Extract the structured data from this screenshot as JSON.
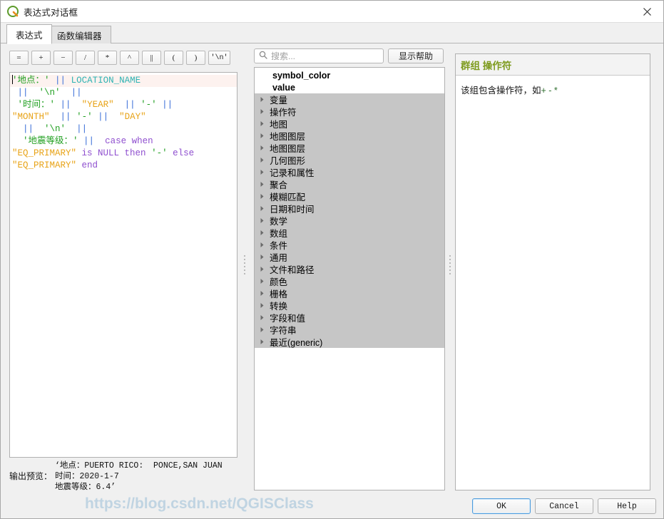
{
  "window": {
    "title": "表达式对话框",
    "logo_icon": "qgis-logo-icon",
    "close_icon": "close-icon"
  },
  "tabs": [
    {
      "id": "expression",
      "label": "表达式",
      "active": true
    },
    {
      "id": "function-editor",
      "label": "函数编辑器",
      "active": false
    }
  ],
  "operator_toolbar": {
    "buttons": [
      {
        "name": "equals",
        "label": "="
      },
      {
        "name": "plus",
        "label": "+"
      },
      {
        "name": "minus",
        "label": "−"
      },
      {
        "name": "divide",
        "label": "/"
      },
      {
        "name": "multiply",
        "label": "*"
      },
      {
        "name": "power",
        "label": "^"
      },
      {
        "name": "concat",
        "label": "||"
      },
      {
        "name": "paren-open",
        "label": "("
      },
      {
        "name": "paren-close",
        "label": ")"
      },
      {
        "name": "newline",
        "label": "'\\n'"
      }
    ]
  },
  "expression": {
    "raw": "'地点：' || LOCATION_NAME\n ||  '\\n'  ||\n '时间：' ||  \"YEAR\"  || '-' ||\n\"MONTH\"  || '-' ||  \"DAY\"\n  ||  '\\n'  ||\n  '地震等级：' ||  case when\n\"EQ_PRIMARY\" is NULL then '-' else\n\"EQ_PRIMARY\" end",
    "lines": [
      {
        "current": true,
        "tokens": [
          {
            "t": "str",
            "v": "'地点：'"
          },
          {
            "t": "pl",
            "v": " "
          },
          {
            "t": "op",
            "v": "||"
          },
          {
            "t": "pl",
            "v": " "
          },
          {
            "t": "col",
            "v": "LOCATION_NAME"
          }
        ]
      },
      {
        "current": false,
        "tokens": [
          {
            "t": "pl",
            "v": " "
          },
          {
            "t": "op",
            "v": "||"
          },
          {
            "t": "pl",
            "v": "  "
          },
          {
            "t": "str",
            "v": "'\\n'"
          },
          {
            "t": "pl",
            "v": "  "
          },
          {
            "t": "op",
            "v": "||"
          }
        ]
      },
      {
        "current": false,
        "tokens": [
          {
            "t": "pl",
            "v": " "
          },
          {
            "t": "str",
            "v": "'时间：'"
          },
          {
            "t": "pl",
            "v": " "
          },
          {
            "t": "op",
            "v": "||"
          },
          {
            "t": "pl",
            "v": "  "
          },
          {
            "t": "fld",
            "v": "\"YEAR\""
          },
          {
            "t": "pl",
            "v": "  "
          },
          {
            "t": "op",
            "v": "||"
          },
          {
            "t": "pl",
            "v": " "
          },
          {
            "t": "str",
            "v": "'-'"
          },
          {
            "t": "pl",
            "v": " "
          },
          {
            "t": "op",
            "v": "||"
          }
        ]
      },
      {
        "current": false,
        "tokens": [
          {
            "t": "fld",
            "v": "\"MONTH\""
          },
          {
            "t": "pl",
            "v": "  "
          },
          {
            "t": "op",
            "v": "||"
          },
          {
            "t": "pl",
            "v": " "
          },
          {
            "t": "str",
            "v": "'-'"
          },
          {
            "t": "pl",
            "v": " "
          },
          {
            "t": "op",
            "v": "||"
          },
          {
            "t": "pl",
            "v": "  "
          },
          {
            "t": "fld",
            "v": "\"DAY\""
          }
        ]
      },
      {
        "current": false,
        "tokens": [
          {
            "t": "pl",
            "v": "  "
          },
          {
            "t": "op",
            "v": "||"
          },
          {
            "t": "pl",
            "v": "  "
          },
          {
            "t": "str",
            "v": "'\\n'"
          },
          {
            "t": "pl",
            "v": "  "
          },
          {
            "t": "op",
            "v": "||"
          }
        ]
      },
      {
        "current": false,
        "tokens": [
          {
            "t": "pl",
            "v": "  "
          },
          {
            "t": "str",
            "v": "'地震等级：'"
          },
          {
            "t": "pl",
            "v": " "
          },
          {
            "t": "op",
            "v": "||"
          },
          {
            "t": "pl",
            "v": "  "
          },
          {
            "t": "kw",
            "v": "case when"
          }
        ]
      },
      {
        "current": false,
        "tokens": [
          {
            "t": "fld",
            "v": "\"EQ_PRIMARY\""
          },
          {
            "t": "pl",
            "v": " "
          },
          {
            "t": "kw",
            "v": "is NULL then"
          },
          {
            "t": "pl",
            "v": " "
          },
          {
            "t": "str",
            "v": "'-'"
          },
          {
            "t": "pl",
            "v": " "
          },
          {
            "t": "kw",
            "v": "else"
          }
        ]
      },
      {
        "current": false,
        "tokens": [
          {
            "t": "fld",
            "v": "\"EQ_PRIMARY\""
          },
          {
            "t": "pl",
            "v": " "
          },
          {
            "t": "kw",
            "v": "end"
          }
        ]
      }
    ]
  },
  "preview": {
    "label": "输出预览：",
    "lines": [
      "‘地点：PUERTO RICO:  PONCE,SAN JUAN",
      "时间：2020-1-7",
      "地震等级：6.4’"
    ]
  },
  "search": {
    "placeholder": "搜索...",
    "value": "",
    "icon": "search-icon"
  },
  "help_button": {
    "label": "显示帮助"
  },
  "tree": {
    "items": [
      {
        "label": "symbol_color",
        "type": "leaf"
      },
      {
        "label": "value",
        "type": "leaf"
      },
      {
        "label": "变量",
        "type": "group"
      },
      {
        "label": "操作符",
        "type": "group"
      },
      {
        "label": "地图",
        "type": "group"
      },
      {
        "label": "地图图层",
        "type": "group"
      },
      {
        "label": "地图图层",
        "type": "group"
      },
      {
        "label": "几何图形",
        "type": "group"
      },
      {
        "label": "记录和属性",
        "type": "group"
      },
      {
        "label": "聚合",
        "type": "group"
      },
      {
        "label": "模糊匹配",
        "type": "group"
      },
      {
        "label": "日期和时间",
        "type": "group"
      },
      {
        "label": "数学",
        "type": "group"
      },
      {
        "label": "数组",
        "type": "group"
      },
      {
        "label": "条件",
        "type": "group"
      },
      {
        "label": "通用",
        "type": "group"
      },
      {
        "label": "文件和路径",
        "type": "group"
      },
      {
        "label": "颜色",
        "type": "group"
      },
      {
        "label": "栅格",
        "type": "group"
      },
      {
        "label": "转换",
        "type": "group"
      },
      {
        "label": "字段和值",
        "type": "group"
      },
      {
        "label": "字符串",
        "type": "group"
      },
      {
        "label": "最近(generic)",
        "type": "group"
      }
    ]
  },
  "help_panel": {
    "title": "群组 操作符",
    "body_prefix": "该组包含操作符，如",
    "body_symbols": "+ - *"
  },
  "dialog_buttons": [
    {
      "name": "ok",
      "label": "OK",
      "default": true
    },
    {
      "name": "cancel",
      "label": "Cancel",
      "default": false
    },
    {
      "name": "help",
      "label": "Help",
      "default": false
    }
  ],
  "watermark": {
    "text": "https://blog.csdn.net/QGISClass"
  },
  "colors": {
    "string": "#22a022",
    "operator": "#3a6fd8",
    "column": "#2fb3b3",
    "field": "#e8a317",
    "keyword": "#8f4fcf",
    "help_title": "#7e9b1e",
    "group_row": "#c6c6c6"
  }
}
